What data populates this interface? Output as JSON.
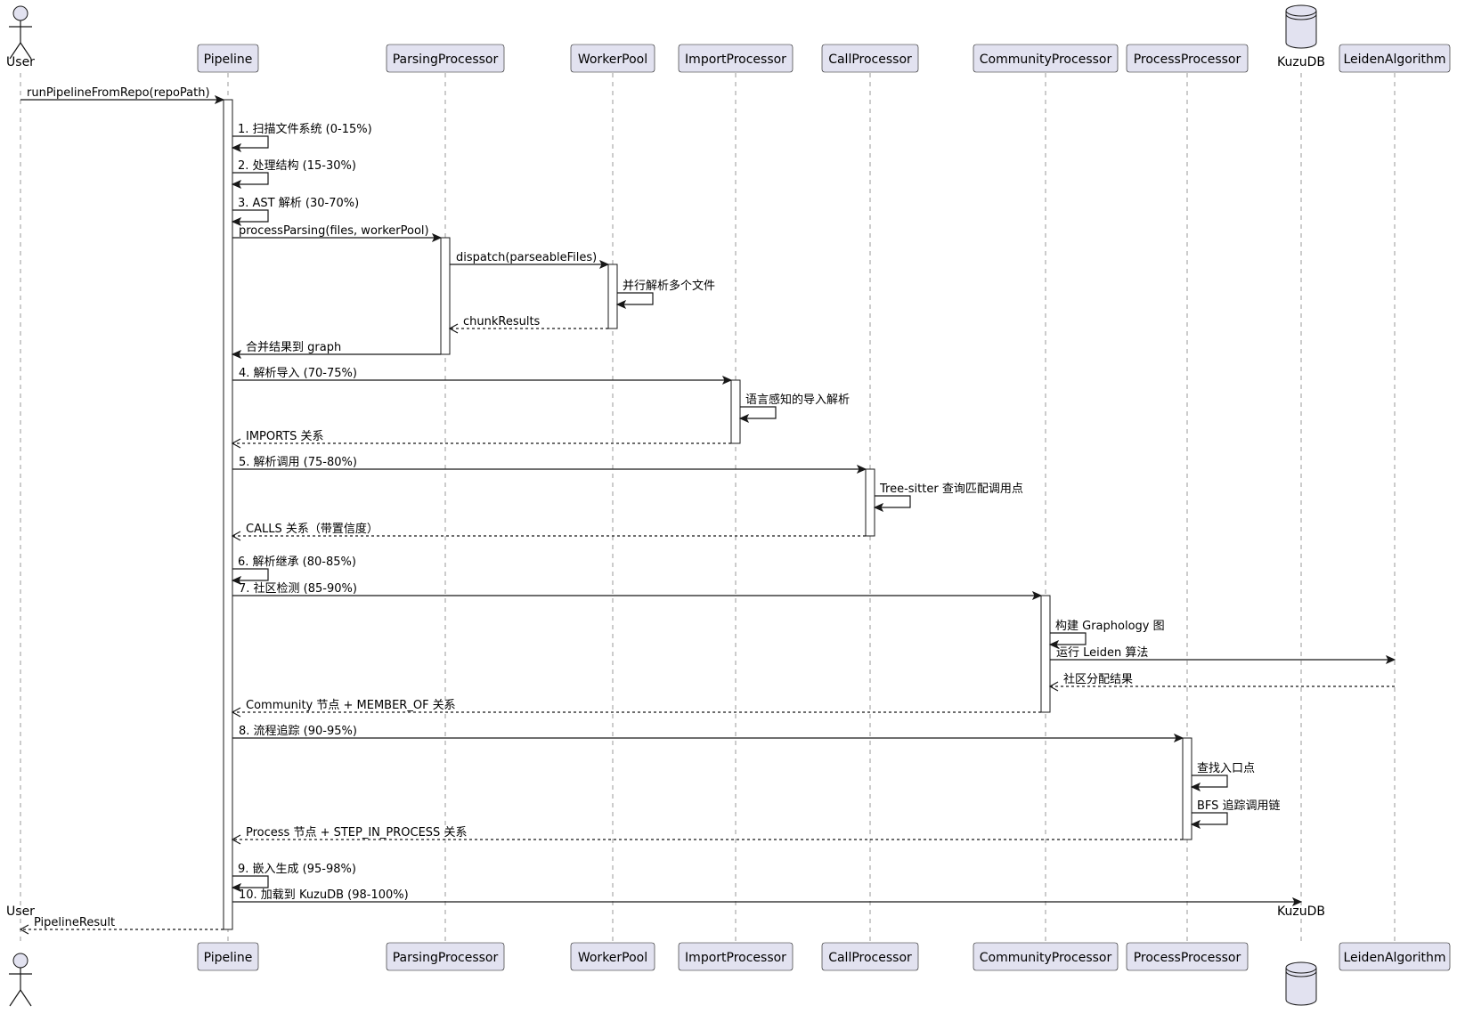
{
  "participants": [
    {
      "id": "user",
      "label": "User",
      "kind": "actor"
    },
    {
      "id": "pipeline",
      "label": "Pipeline",
      "kind": "participant"
    },
    {
      "id": "parsing",
      "label": "ParsingProcessor",
      "kind": "participant"
    },
    {
      "id": "worker",
      "label": "WorkerPool",
      "kind": "participant"
    },
    {
      "id": "import",
      "label": "ImportProcessor",
      "kind": "participant"
    },
    {
      "id": "call",
      "label": "CallProcessor",
      "kind": "participant"
    },
    {
      "id": "community",
      "label": "CommunityProcessor",
      "kind": "participant"
    },
    {
      "id": "process",
      "label": "ProcessProcessor",
      "kind": "participant"
    },
    {
      "id": "kuzu",
      "label": "KuzuDB",
      "kind": "database"
    },
    {
      "id": "leiden",
      "label": "LeidenAlgorithm",
      "kind": "participant"
    }
  ],
  "messages": [
    {
      "from": "user",
      "to": "pipeline",
      "label": "runPipelineFromRepo(repoPath)",
      "style": "solid"
    },
    {
      "from": "pipeline",
      "to": "pipeline",
      "label": "1. 扫描文件系统 (0-15%)",
      "style": "self"
    },
    {
      "from": "pipeline",
      "to": "pipeline",
      "label": "2. 处理结构 (15-30%)",
      "style": "self"
    },
    {
      "from": "pipeline",
      "to": "pipeline",
      "label": "3. AST 解析 (30-70%)",
      "style": "self"
    },
    {
      "from": "pipeline",
      "to": "parsing",
      "label": "processParsing(files, workerPool)",
      "style": "solid"
    },
    {
      "from": "parsing",
      "to": "worker",
      "label": "dispatch(parseableFiles)",
      "style": "solid"
    },
    {
      "from": "worker",
      "to": "worker",
      "label": "并行解析多个文件",
      "style": "self"
    },
    {
      "from": "worker",
      "to": "parsing",
      "label": "chunkResults",
      "style": "dashed"
    },
    {
      "from": "parsing",
      "to": "pipeline",
      "label": "合并结果到 graph",
      "style": "solid"
    },
    {
      "from": "pipeline",
      "to": "import",
      "label": "4. 解析导入 (70-75%)",
      "style": "solid"
    },
    {
      "from": "import",
      "to": "import",
      "label": "语言感知的导入解析",
      "style": "self"
    },
    {
      "from": "import",
      "to": "pipeline",
      "label": "IMPORTS 关系",
      "style": "dashed"
    },
    {
      "from": "pipeline",
      "to": "call",
      "label": "5. 解析调用 (75-80%)",
      "style": "solid"
    },
    {
      "from": "call",
      "to": "call",
      "label": "Tree-sitter 查询匹配调用点",
      "style": "self"
    },
    {
      "from": "call",
      "to": "pipeline",
      "label": "CALLS 关系（带置信度）",
      "style": "dashed"
    },
    {
      "from": "pipeline",
      "to": "pipeline",
      "label": "6. 解析继承 (80-85%)",
      "style": "self"
    },
    {
      "from": "pipeline",
      "to": "community",
      "label": "7. 社区检测 (85-90%)",
      "style": "solid"
    },
    {
      "from": "community",
      "to": "community",
      "label": "构建 Graphology 图",
      "style": "self"
    },
    {
      "from": "community",
      "to": "leiden",
      "label": "运行 Leiden 算法",
      "style": "solid"
    },
    {
      "from": "leiden",
      "to": "community",
      "label": "社区分配结果",
      "style": "dashed"
    },
    {
      "from": "community",
      "to": "pipeline",
      "label": "Community 节点 + MEMBER_OF 关系",
      "style": "dashed"
    },
    {
      "from": "pipeline",
      "to": "process",
      "label": "8. 流程追踪 (90-95%)",
      "style": "solid"
    },
    {
      "from": "process",
      "to": "process",
      "label": "查找入口点",
      "style": "self"
    },
    {
      "from": "process",
      "to": "process",
      "label": "BFS 追踪调用链",
      "style": "self"
    },
    {
      "from": "process",
      "to": "pipeline",
      "label": "Process 节点 + STEP_IN_PROCESS 关系",
      "style": "dashed"
    },
    {
      "from": "pipeline",
      "to": "pipeline",
      "label": "9. 嵌入生成 (95-98%)",
      "style": "self"
    },
    {
      "from": "pipeline",
      "to": "kuzu",
      "label": "10. 加载到 KuzuDB (98-100%)",
      "style": "solid"
    },
    {
      "from": "pipeline",
      "to": "user",
      "label": "PipelineResult",
      "style": "dashed"
    }
  ]
}
